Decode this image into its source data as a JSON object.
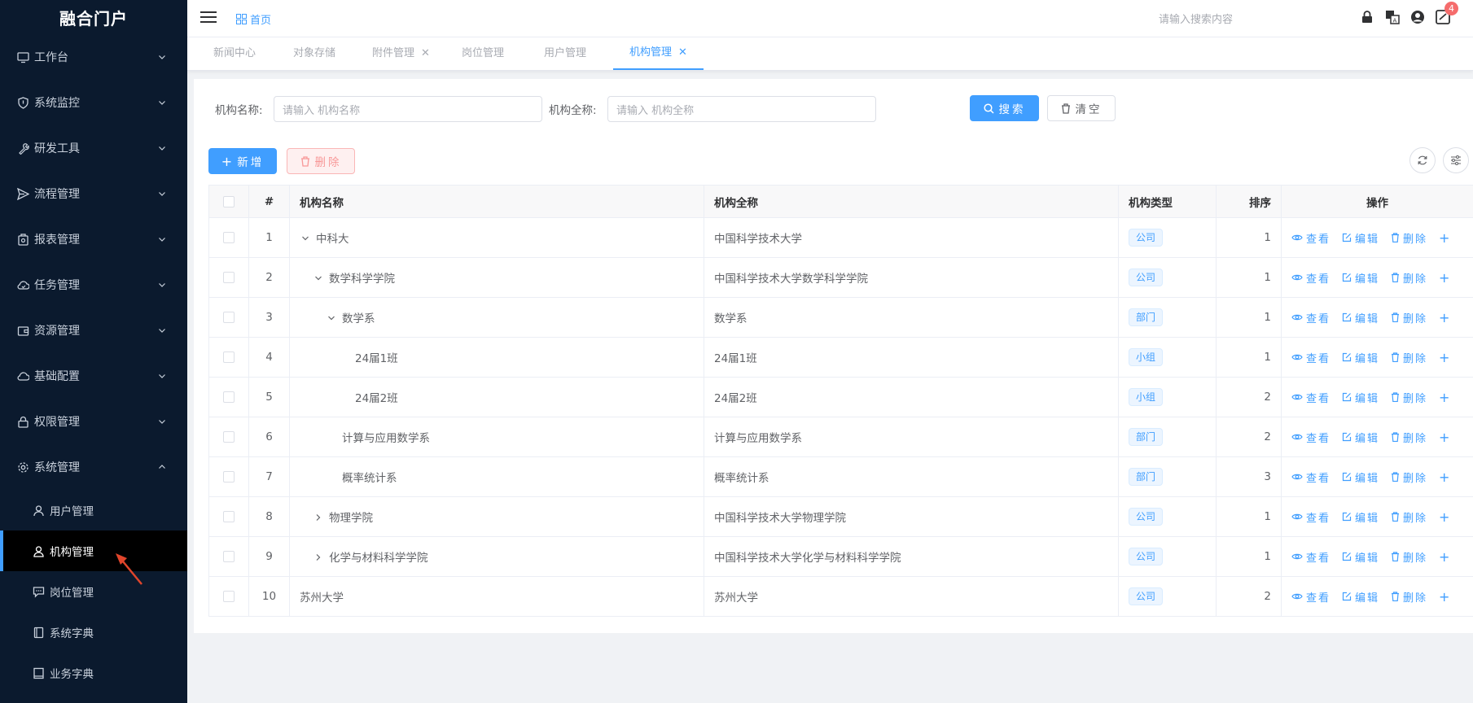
{
  "app": {
    "title": "融合门户"
  },
  "sidebar": {
    "items": [
      {
        "label": "工作台",
        "icon": "monitor-icon"
      },
      {
        "label": "系统监控",
        "icon": "shield-icon"
      },
      {
        "label": "研发工具",
        "icon": "tools-icon"
      },
      {
        "label": "流程管理",
        "icon": "send-icon"
      },
      {
        "label": "报表管理",
        "icon": "report-icon"
      },
      {
        "label": "任务管理",
        "icon": "cloud-icon"
      },
      {
        "label": "资源管理",
        "icon": "wallet-icon"
      },
      {
        "label": "基础配置",
        "icon": "cloud-config-icon"
      },
      {
        "label": "权限管理",
        "icon": "lock-icon"
      },
      {
        "label": "系统管理",
        "icon": "gear-icon"
      }
    ],
    "subitems": [
      {
        "label": "用户管理",
        "icon": "user-icon"
      },
      {
        "label": "机构管理",
        "icon": "org-icon",
        "active": true
      },
      {
        "label": "岗位管理",
        "icon": "chat-icon"
      },
      {
        "label": "系统字典",
        "icon": "dict-icon"
      },
      {
        "label": "业务字典",
        "icon": "book-icon"
      }
    ]
  },
  "header": {
    "home": "首页",
    "search_placeholder": "请输入搜索内容",
    "notification_count": "4"
  },
  "tabs": [
    {
      "label": "新闻中心",
      "closable": false
    },
    {
      "label": "对象存储",
      "closable": false
    },
    {
      "label": "附件管理",
      "closable": true
    },
    {
      "label": "岗位管理",
      "closable": false
    },
    {
      "label": "用户管理",
      "closable": false
    },
    {
      "label": "机构管理",
      "closable": true,
      "active": true
    }
  ],
  "search": {
    "name_label": "机构名称:",
    "name_placeholder": "请输入 机构名称",
    "fullname_label": "机构全称:",
    "fullname_placeholder": "请输入 机构全称",
    "search_btn": "搜索",
    "clear_btn": "清空"
  },
  "toolbar": {
    "add_btn": "新增",
    "delete_btn": "删除"
  },
  "table": {
    "headers": {
      "index": "#",
      "name": "机构名称",
      "fullname": "机构全称",
      "type": "机构类型",
      "sort": "排序",
      "actions": "操作"
    },
    "action_labels": {
      "view": "查看",
      "edit": "编辑",
      "delete": "删除"
    },
    "rows": [
      {
        "index": "1",
        "name": "中科大",
        "fullname": "中国科学技术大学",
        "type": "公司",
        "sort": "1",
        "level": 0,
        "expander": "down"
      },
      {
        "index": "2",
        "name": "数学科学学院",
        "fullname": "中国科学技术大学数学科学学院",
        "type": "公司",
        "sort": "1",
        "level": 1,
        "expander": "down"
      },
      {
        "index": "3",
        "name": "数学系",
        "fullname": "数学系",
        "type": "部门",
        "sort": "1",
        "level": 2,
        "expander": "down"
      },
      {
        "index": "4",
        "name": "24届1班",
        "fullname": "24届1班",
        "type": "小组",
        "sort": "1",
        "level": 3,
        "expander": "none"
      },
      {
        "index": "5",
        "name": "24届2班",
        "fullname": "24届2班",
        "type": "小组",
        "sort": "2",
        "level": 3,
        "expander": "none"
      },
      {
        "index": "6",
        "name": "计算与应用数学系",
        "fullname": "计算与应用数学系",
        "type": "部门",
        "sort": "2",
        "level": 2,
        "expander": "none"
      },
      {
        "index": "7",
        "name": "概率统计系",
        "fullname": "概率统计系",
        "type": "部门",
        "sort": "3",
        "level": 2,
        "expander": "none"
      },
      {
        "index": "8",
        "name": "物理学院",
        "fullname": "中国科学技术大学物理学院",
        "type": "公司",
        "sort": "1",
        "level": 1,
        "expander": "right"
      },
      {
        "index": "9",
        "name": "化学与材料科学学院",
        "fullname": "中国科学技术大学化学与材料科学学院",
        "type": "公司",
        "sort": "1",
        "level": 1,
        "expander": "right"
      },
      {
        "index": "10",
        "name": "苏州大学",
        "fullname": "苏州大学",
        "type": "公司",
        "sort": "2",
        "level": 0,
        "expander": "none"
      }
    ]
  },
  "colors": {
    "sidebar_bg": "#0b1a2e",
    "accent": "#409eff",
    "danger": "#f56c6c"
  }
}
